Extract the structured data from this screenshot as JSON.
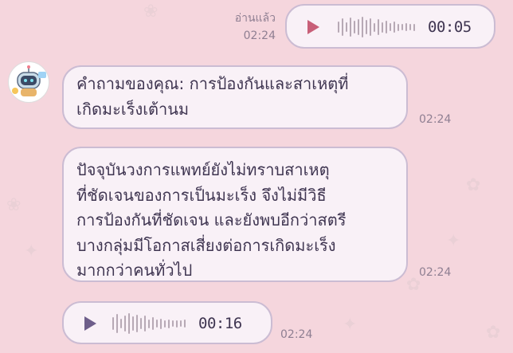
{
  "theme": {
    "background": "#f5d6dd",
    "bubble_fill": "#f9f1f7",
    "bubble_border": "#cbbcd3",
    "text_color": "#3f3551",
    "play_outgoing": "#c85f78",
    "play_incoming": "#6e5e8a"
  },
  "messages": [
    {
      "id": "m1",
      "direction": "outgoing",
      "type": "audio",
      "read_status": "อ่านแล้ว",
      "time": "02:24",
      "duration": "00:05",
      "icon": "play-icon"
    },
    {
      "id": "m2",
      "direction": "incoming",
      "type": "text",
      "sender_avatar": "bot-avatar-icon",
      "text": "คำถามของคุณ: การป้องกันและสาเหตุที่\nเกิดมะเร็งเต้านม",
      "time": "02:24"
    },
    {
      "id": "m3",
      "direction": "incoming",
      "type": "text",
      "text": "ปัจจุบันวงการแพทย์ยังไม่ทราบสาเหตุ\nที่ชัดเจนของการเป็นมะเร็ง จึงไม่มีวิธี\nการป้องกันที่ชัดเจน และยังพบอีกว่าสตรี\nบางกลุ่มมีโอกาสเสี่ยงต่อการเกิดมะเร็ง\nมากกว่าคนทั่วไป",
      "time": "02:24"
    },
    {
      "id": "m4",
      "direction": "incoming",
      "type": "audio",
      "duration": "00:16",
      "time": "02:24",
      "icon": "play-icon"
    }
  ]
}
